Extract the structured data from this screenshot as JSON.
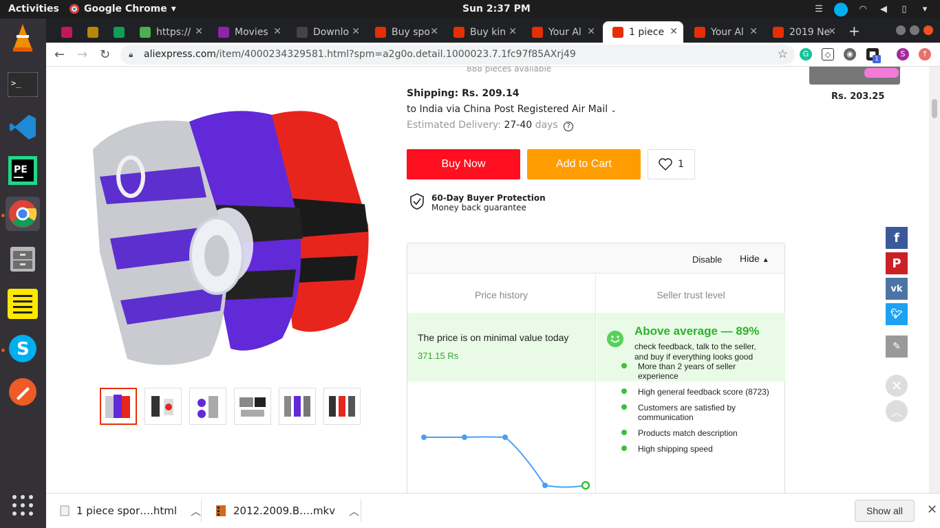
{
  "system": {
    "activities": "Activities",
    "app_name": "Google Chrome",
    "clock": "Sun  2:37 PM"
  },
  "browser": {
    "tabs": [
      {
        "label": "",
        "color": "#c2185b"
      },
      {
        "label": "",
        "color": "#b8860b"
      },
      {
        "label": "",
        "color": "#0f9d58"
      },
      {
        "label": "https://",
        "color": "#4caf50"
      },
      {
        "label": "Movies",
        "color": "#8e24aa"
      },
      {
        "label": "Downlo",
        "color": "#444444"
      },
      {
        "label": "Buy spo",
        "color": "#e62e04"
      },
      {
        "label": "Buy kin",
        "color": "#e62e04"
      },
      {
        "label": "Your Al",
        "color": "#e62e04"
      },
      {
        "label": "1 piece",
        "color": "#e62e04"
      },
      {
        "label": "Your Al",
        "color": "#e62e04"
      },
      {
        "label": "2019 Ne",
        "color": "#e62e04"
      }
    ],
    "url_host": "aliexpress.com",
    "url_path": "/item/4000234329581.html?spm=a2g0o.detail.1000023.7.1fc97f85AXrj49",
    "extension_badge": "1",
    "profile_initial": "S"
  },
  "product": {
    "stock_text": "888 pieces available",
    "shipping_label": "Shipping: Rs. 209.14",
    "shipping_via": "to India via China Post Registered Air Mail",
    "est_label": "Estimated Delivery:",
    "est_value": "27-40",
    "est_unit": "days",
    "buy_now": "Buy Now",
    "add_to_cart": "Add to Cart",
    "wishlist_count": "1",
    "protection_title": "60-Day Buyer Protection",
    "protection_sub": "Money back guarantee",
    "side_price": "Rs. 203.25"
  },
  "widget": {
    "disable": "Disable",
    "hide": "Hide",
    "price_history_title": "Price history",
    "seller_trust_title": "Seller trust level",
    "price_msg": "The price is on minimal value today",
    "price_value": "371.15 Rs",
    "trust_headline": "Above average — 89%",
    "trust_desc": "check feedback, talk to the seller, and buy if everything looks good",
    "trust_items": [
      "More than 2 years of seller experience",
      "High general feedback score (8723)",
      "Customers are satisfied by communication",
      "Products match description",
      "High shipping speed"
    ]
  },
  "downloads": {
    "item1": "1 piece spor….html",
    "item2": "2012.2009.B….mkv",
    "show_all": "Show all"
  },
  "colors": {
    "buy": "#ff0f1f",
    "cart": "#ff9d00",
    "trust_green": "#2ab22a"
  }
}
